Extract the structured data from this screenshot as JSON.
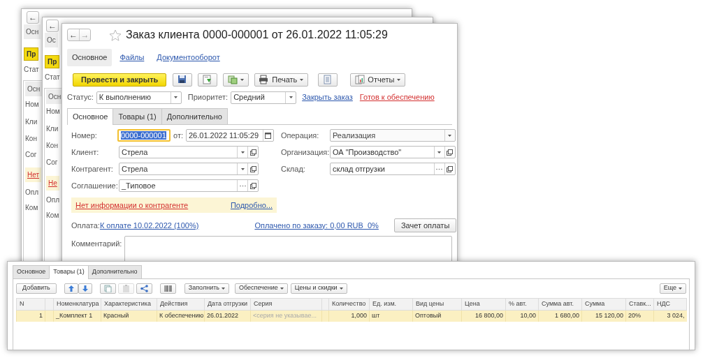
{
  "back_windows": [
    {
      "nav": [
        "←"
      ],
      "lines": [
        {
          "kind": "tab",
          "text": "Осн"
        },
        {
          "kind": "primary",
          "text": "Пр"
        },
        {
          "kind": "label",
          "text": "Стат"
        },
        {
          "kind": "tab",
          "text": "Осн"
        },
        {
          "kind": "label",
          "text": "Ном"
        },
        {
          "kind": "label",
          "text": "Кли"
        },
        {
          "kind": "label",
          "text": "Кон"
        },
        {
          "kind": "label",
          "text": "Сог"
        },
        {
          "kind": "warning",
          "text": "Нет"
        },
        {
          "kind": "label",
          "text": "Опл"
        },
        {
          "kind": "label",
          "text": "Ком"
        }
      ]
    },
    {
      "nav": [
        "←"
      ],
      "lines": [
        {
          "kind": "tab",
          "text": "Ос"
        },
        {
          "kind": "primary",
          "text": "Пр"
        },
        {
          "kind": "label",
          "text": "Стат"
        },
        {
          "kind": "tab",
          "text": "Осн"
        },
        {
          "kind": "label",
          "text": "Ном"
        },
        {
          "kind": "label",
          "text": "Кли"
        },
        {
          "kind": "label",
          "text": "Кон"
        },
        {
          "kind": "label",
          "text": "Сог"
        },
        {
          "kind": "warning",
          "text": "Не"
        },
        {
          "kind": "label",
          "text": "Опл"
        },
        {
          "kind": "label",
          "text": "Ком"
        }
      ]
    }
  ],
  "window": {
    "title": "Заказ клиента 0000-000001 от 26.01.2022 11:05:29",
    "nav": [
      "←",
      "→"
    ],
    "favorite": false,
    "sections": [
      {
        "label": "Основное",
        "selected": true
      },
      {
        "label": "Файлы",
        "selected": false
      },
      {
        "label": "Документооборот",
        "selected": false
      }
    ],
    "toolbar": [
      {
        "kind": "primary",
        "label": "Провести и закрыть"
      },
      {
        "kind": "icon"
      },
      {
        "kind": "icon"
      },
      {
        "kind": "icon-menu"
      },
      {
        "kind": "menu",
        "label": "Печать"
      },
      {
        "kind": "icon"
      },
      {
        "kind": "menu",
        "label": "Отчеты"
      }
    ],
    "status": {
      "label": "Статус:",
      "value": "К выполнению",
      "priority_label": "Приоритет:",
      "priority": "Средний",
      "links": [
        {
          "text": "Закрыть заказ",
          "kind": "normal"
        },
        {
          "text": "Готов к обеспечению",
          "kind": "alert"
        }
      ]
    },
    "tabs": [
      {
        "label": "Основное",
        "selected": true
      },
      {
        "label": "Товары (1)",
        "selected": false
      },
      {
        "label": "Дополнительно",
        "selected": false
      }
    ],
    "number": {
      "label": "Номер:",
      "value": "0000-000001",
      "focused": true,
      "date_label": "от:",
      "date": "26.01.2022 11:05:29"
    },
    "left_fields": [
      {
        "label": "Клиент:",
        "value": "Стрела",
        "buttons": [
          {
            "kind": "caret"
          },
          {
            "kind": "open"
          }
        ]
      },
      {
        "label": "Контрагент:",
        "value": "Стрела",
        "buttons": [
          {
            "kind": "caret"
          },
          {
            "kind": "open"
          }
        ]
      },
      {
        "label": "Соглашение:",
        "value": "_Типовое",
        "buttons": [
          {
            "kind": "choose"
          },
          {
            "kind": "open"
          }
        ]
      }
    ],
    "right_fields": [
      {
        "label": "Операция:",
        "value": "Реализация",
        "disabled": true,
        "buttons": [
          {
            "kind": "caret"
          }
        ]
      },
      {
        "label": "Организация:",
        "value": "ОА \"Производство\"",
        "disabled": false,
        "buttons": [
          {
            "kind": "caret"
          },
          {
            "kind": "open"
          }
        ]
      },
      {
        "label": "Склад:",
        "value": "склад отгрузки",
        "disabled": false,
        "buttons": [
          {
            "kind": "choose"
          },
          {
            "kind": "open"
          }
        ]
      }
    ],
    "warning": {
      "text": "Нет информации о контрагенте",
      "link": "Подробно..."
    },
    "payment": {
      "label": "Оплата:",
      "link": "К оплате 10.02.2022 (100%)",
      "paid_link": "Оплачено по заказу: 0,00 RUB  0%",
      "button": "Зачет оплаты"
    },
    "comment": {
      "label": "Комментарий:"
    }
  },
  "goods_panel": {
    "tabs": [
      {
        "label": "Основное",
        "selected": false
      },
      {
        "label": "Товары (1)",
        "selected": true
      },
      {
        "label": "Дополнительно",
        "selected": false
      }
    ],
    "toolbar": [
      {
        "kind": "button",
        "label": "Добавить"
      },
      {
        "kind": "updown"
      },
      {
        "kind": "icon",
        "disabled": false
      },
      {
        "kind": "icon",
        "disabled": true
      },
      {
        "kind": "icon",
        "disabled": false
      },
      {
        "kind": "icon",
        "disabled": false
      },
      {
        "kind": "menu",
        "label": "Заполнить"
      },
      {
        "kind": "menu",
        "label": "Обеспечение"
      },
      {
        "kind": "menu",
        "label": "Цены и скидки"
      },
      {
        "kind": "more",
        "label": "Еще"
      }
    ],
    "table": {
      "columns": [
        {
          "label": "N",
          "kind": "number"
        },
        {
          "kind": "text"
        },
        {
          "label": "Номенклатура",
          "kind": "text"
        },
        {
          "label": "Характеристика",
          "kind": "text"
        },
        {
          "label": "Действия",
          "kind": "text"
        },
        {
          "label": "Дата отгрузки",
          "kind": "text"
        },
        {
          "label": "Серия",
          "kind": "text"
        },
        {
          "kind": "text"
        },
        {
          "label": "Количество",
          "kind": "number"
        },
        {
          "label": "Ед. изм.",
          "kind": "text"
        },
        {
          "label": "Вид цены",
          "kind": "text"
        },
        {
          "label": "Цена",
          "kind": "number"
        },
        {
          "label": "% авт.",
          "kind": "number"
        },
        {
          "label": "Сумма авт.",
          "kind": "number"
        },
        {
          "label": "Сумма",
          "kind": "number"
        },
        {
          "label": "Ставк...",
          "kind": "text"
        },
        {
          "label": "НДС",
          "kind": "number"
        }
      ],
      "rows": [
        {
          "selected": true,
          "cells": [
            {
              "text": "1"
            },
            {
              "text": ""
            },
            {
              "text": "_Комплект 1"
            },
            {
              "text": "Красный"
            },
            {
              "text": "К обеспечению"
            },
            {
              "text": "26.01.2022"
            },
            {
              "text": "<серия не указывае...",
              "placeholder": true
            },
            {
              "text": ""
            },
            {
              "text": "1,000"
            },
            {
              "text": "шт"
            },
            {
              "text": "Оптовый"
            },
            {
              "text": "16 800,00"
            },
            {
              "text": "10,00"
            },
            {
              "text": "1 680,00"
            },
            {
              "text": "15 120,00"
            },
            {
              "text": "20%"
            },
            {
              "text": "3 024,"
            }
          ]
        }
      ]
    }
  }
}
